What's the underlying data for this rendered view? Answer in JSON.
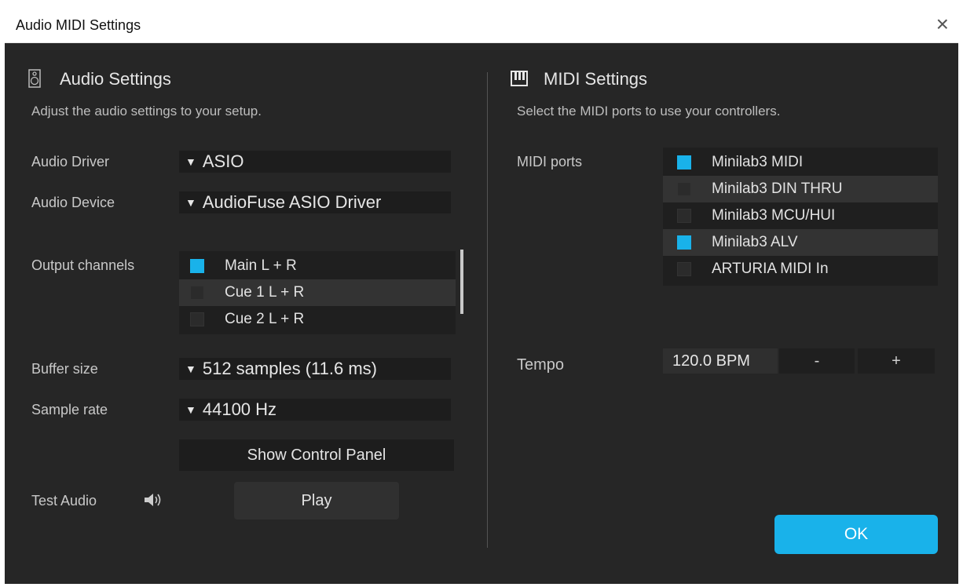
{
  "window": {
    "title": "Audio MIDI Settings",
    "close_glyph": "×"
  },
  "audio": {
    "title": "Audio Settings",
    "icon": "speaker-icon",
    "description": "Adjust the audio settings to your setup.",
    "driver_label": "Audio Driver",
    "driver_value": "ASIO",
    "device_label": "Audio Device",
    "device_value": "AudioFuse ASIO Driver",
    "output_label": "Output channels",
    "outputs": [
      {
        "label": "Main L + R",
        "checked": true
      },
      {
        "label": "Cue 1 L + R",
        "checked": false
      },
      {
        "label": "Cue 2 L + R",
        "checked": false
      }
    ],
    "buffer_label": "Buffer size",
    "buffer_value": "512 samples (11.6 ms)",
    "rate_label": "Sample rate",
    "rate_value": "44100 Hz",
    "control_panel_label": "Show Control Panel",
    "test_label": "Test Audio",
    "test_icon": "volume-icon",
    "play_label": "Play"
  },
  "midi": {
    "title": "MIDI Settings",
    "icon": "piano-keys-icon",
    "description": "Select the MIDI ports to use your controllers.",
    "ports_label": "MIDI ports",
    "ports": [
      {
        "label": "Minilab3 MIDI",
        "checked": true
      },
      {
        "label": "Minilab3 DIN THRU",
        "checked": false
      },
      {
        "label": "Minilab3 MCU/HUI",
        "checked": false
      },
      {
        "label": "Minilab3 ALV",
        "checked": true
      },
      {
        "label": "ARTURIA MIDI In",
        "checked": false
      }
    ],
    "tempo_label": "Tempo",
    "tempo_value": "120.0 BPM",
    "tempo_minus": "-",
    "tempo_plus": "+",
    "ok_label": "OK"
  },
  "colors": {
    "accent": "#19b2ea",
    "background": "#262626",
    "field": "#1d1d1d"
  }
}
